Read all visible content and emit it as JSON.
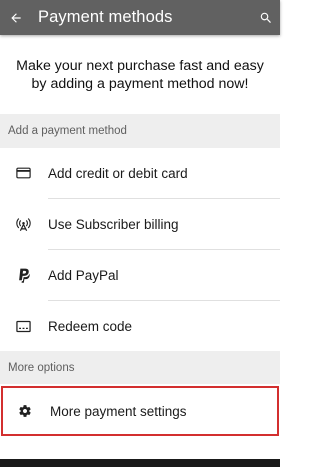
{
  "header": {
    "title": "Payment methods",
    "back_icon": "arrow-back-icon",
    "search_icon": "search-icon",
    "background_color": "#616161"
  },
  "intro": {
    "text": "Make your next purchase fast and easy by adding a payment method now!"
  },
  "add_section": {
    "header": "Add a payment method",
    "items": [
      {
        "label": "Add credit or debit card",
        "icon": "credit-card-icon"
      },
      {
        "label": "Use Subscriber billing",
        "icon": "antenna-icon"
      },
      {
        "label": "Add PayPal",
        "icon": "paypal-icon"
      },
      {
        "label": "Redeem code",
        "icon": "gift-code-icon"
      }
    ]
  },
  "more_section": {
    "header": "More options",
    "items": [
      {
        "label": "More payment settings",
        "icon": "gear-icon",
        "highlighted": true
      }
    ]
  },
  "highlight_color": "#d32f2f"
}
